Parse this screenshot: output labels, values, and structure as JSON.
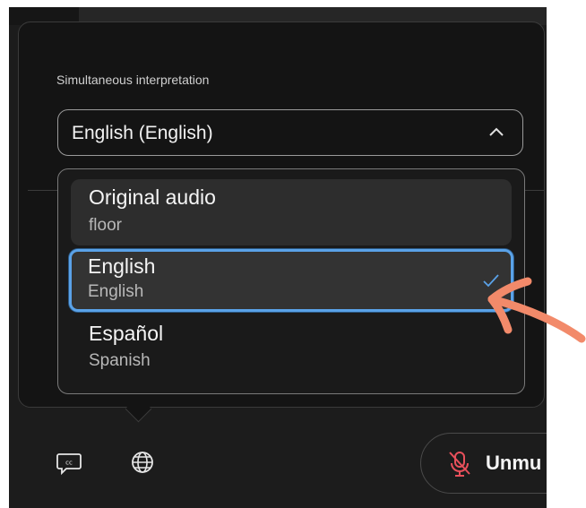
{
  "panel": {
    "section_label": "Simultaneous interpretation",
    "selected_value": "English (English)"
  },
  "dropdown": {
    "options": [
      {
        "label": "Original audio",
        "sublabel": "floor",
        "selected": false
      },
      {
        "label": "English",
        "sublabel": "English",
        "selected": true
      },
      {
        "label": "Español",
        "sublabel": "Spanish",
        "selected": false
      }
    ]
  },
  "toolbar": {
    "unmute_label": "Unmu"
  },
  "icons": {
    "captions": "closed-captions-icon",
    "language": "globe-icon",
    "microphone": "mic-off-icon",
    "chevron": "chevron-up-icon",
    "check": "checkmark-icon",
    "annotation": "arrow-icon"
  },
  "colors": {
    "background": "#1c1c1c",
    "focus_ring": "#5aa2e8",
    "mic_off": "#e8505b",
    "annotation_arrow": "#f28a6a"
  }
}
